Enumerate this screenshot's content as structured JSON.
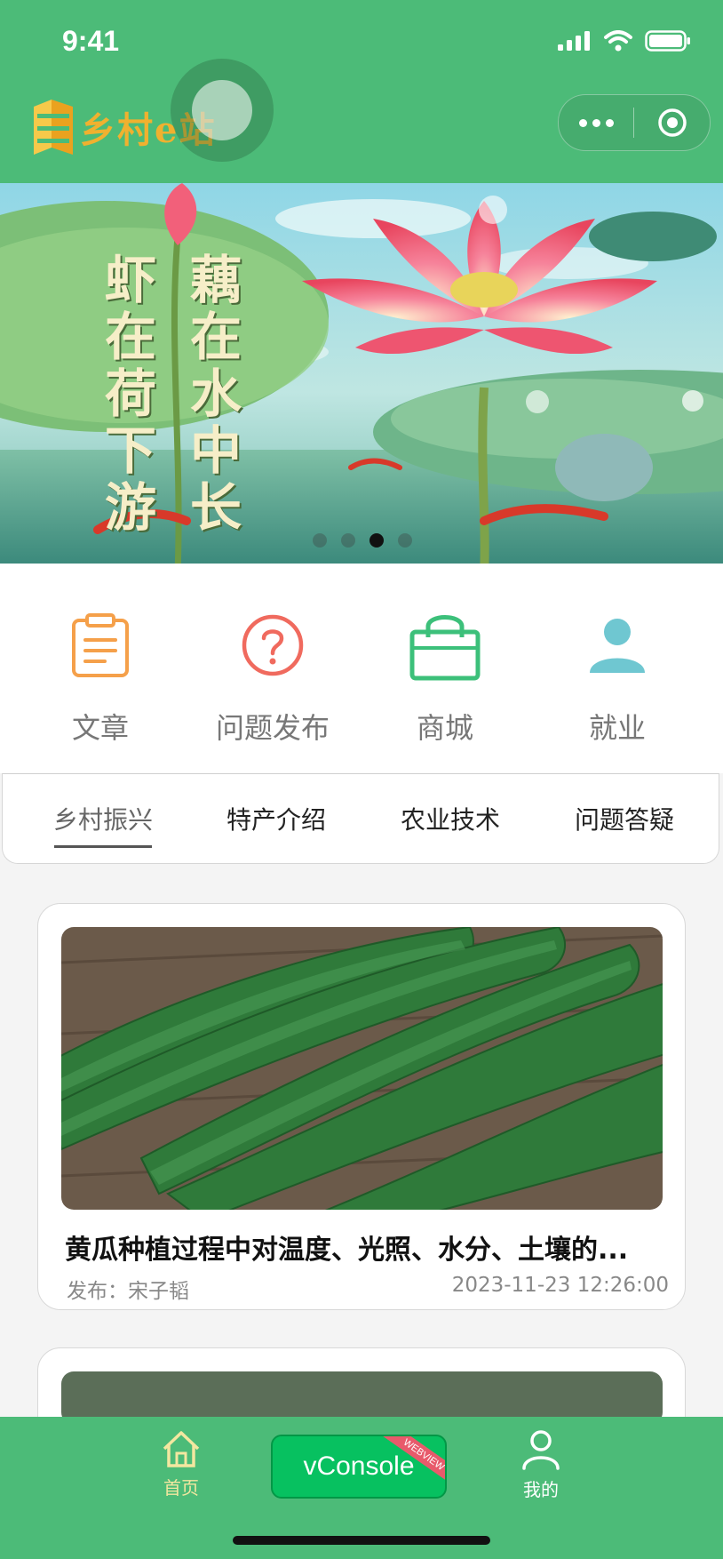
{
  "status_bar": {
    "time": "9:41"
  },
  "header": {
    "logo_text": "乡村e站"
  },
  "banner": {
    "poem_col1": "藕在水中长",
    "poem_col2": "虾在荷下游",
    "slide_count": 4,
    "active_slide": 3
  },
  "quick_menu": [
    {
      "label": "文章",
      "icon": "clipboard-icon",
      "color": "#f5a04a"
    },
    {
      "label": "问题发布",
      "icon": "question-circle-icon",
      "color": "#f06a5e"
    },
    {
      "label": "商城",
      "icon": "shopping-bag-icon",
      "color": "#3cc07a"
    },
    {
      "label": "就业",
      "icon": "person-icon",
      "color": "#6fc7d1"
    }
  ],
  "tabs": {
    "items": [
      "乡村振兴",
      "特产介绍",
      "农业技术",
      "问题答疑"
    ],
    "active": 0
  },
  "articles": [
    {
      "title": "黄瓜种植过程中对温度、光照、水分、土壤的...",
      "author": "发布：宋子韬",
      "date": "2023-11-23 12:26:00"
    }
  ],
  "tabbar": {
    "home_label": "首页",
    "mine_label": "我的",
    "vconsole_label": "vConsole",
    "vconsole_ribbon": "WEBVIEW"
  },
  "colors": {
    "brand_green": "#4cbb78",
    "accent_gold": "#f0b12f",
    "vconsole_green": "#07c160"
  }
}
